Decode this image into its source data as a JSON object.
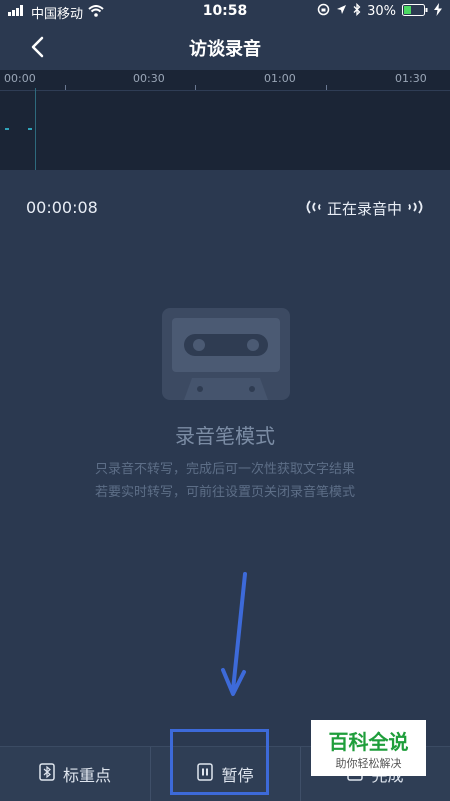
{
  "status_bar": {
    "carrier": "中国移动",
    "time": "10:58",
    "battery": "30%"
  },
  "nav": {
    "title": "访谈录音"
  },
  "timeline": {
    "ticks": [
      "00:00",
      "00:30",
      "01:00",
      "01:30"
    ]
  },
  "recording": {
    "elapsed": "00:00:08",
    "status": "正在录音中"
  },
  "mode": {
    "title": "录音笔模式",
    "line1": "只录音不转写，完成后可一次性获取文字结果",
    "line2": "若要实时转写，可前往设置页关闭录音笔模式"
  },
  "bottom_bar": {
    "mark_label": "标重点",
    "pause_label": "暂停",
    "finish_label": "完成"
  },
  "watermark": {
    "title": "百科全说",
    "subtitle": "助你轻松解决"
  },
  "colors": {
    "background": "#2b3950",
    "timeline": "#1b2536",
    "highlight": "#3d6ad9",
    "battery": "#4cd964"
  }
}
